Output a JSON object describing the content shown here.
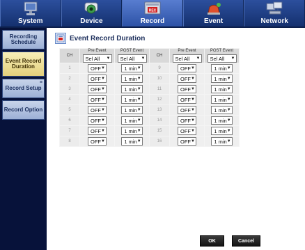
{
  "nav": {
    "tabs": [
      {
        "label": "System",
        "icon": "computer-icon"
      },
      {
        "label": "Device",
        "icon": "camera-icon"
      },
      {
        "label": "Record",
        "icon": "rec-icon",
        "badge": "REC"
      },
      {
        "label": "Event",
        "icon": "alarm-icon"
      },
      {
        "label": "Network",
        "icon": "network-icon"
      }
    ],
    "active": "Record"
  },
  "sidebar": {
    "items": [
      {
        "label": "Recording Schedule"
      },
      {
        "label": "Event Record Duration"
      },
      {
        "label": "Record Setup"
      },
      {
        "label": "Record Option"
      }
    ],
    "active": "Event Record Duration"
  },
  "page": {
    "title": "Event Record Duration"
  },
  "table": {
    "headers": {
      "ch": "CH",
      "pre_event": "Pre Event",
      "post_event": "POST Event",
      "sel_all": "Sel All"
    },
    "left_rows": [
      {
        "ch": "1",
        "pre": "OFF",
        "post": "1 min"
      },
      {
        "ch": "2",
        "pre": "OFF",
        "post": "1 min"
      },
      {
        "ch": "3",
        "pre": "OFF",
        "post": "1 min"
      },
      {
        "ch": "4",
        "pre": "OFF",
        "post": "1 min"
      },
      {
        "ch": "5",
        "pre": "OFF",
        "post": "1 min"
      },
      {
        "ch": "6",
        "pre": "OFF",
        "post": "1 min"
      },
      {
        "ch": "7",
        "pre": "OFF",
        "post": "1 min"
      },
      {
        "ch": "8",
        "pre": "OFF",
        "post": "1 min"
      }
    ],
    "right_rows": [
      {
        "ch": "9",
        "pre": "OFF",
        "post": "1 min"
      },
      {
        "ch": "10",
        "pre": "OFF",
        "post": "1 min"
      },
      {
        "ch": "11",
        "pre": "OFF",
        "post": "1 min"
      },
      {
        "ch": "12",
        "pre": "OFF",
        "post": "1 min"
      },
      {
        "ch": "13",
        "pre": "OFF",
        "post": "1 min"
      },
      {
        "ch": "14",
        "pre": "OFF",
        "post": "1 min"
      },
      {
        "ch": "15",
        "pre": "OFF",
        "post": "1 min"
      },
      {
        "ch": "16",
        "pre": "OFF",
        "post": "1 min"
      }
    ]
  },
  "buttons": {
    "ok": "OK",
    "cancel": "Cancel"
  },
  "colors": {
    "nav_bg": "#1d3c85",
    "sidebar_bg": "#07123a",
    "active_side": "#f0e39e",
    "title": "#1d2f5c"
  }
}
